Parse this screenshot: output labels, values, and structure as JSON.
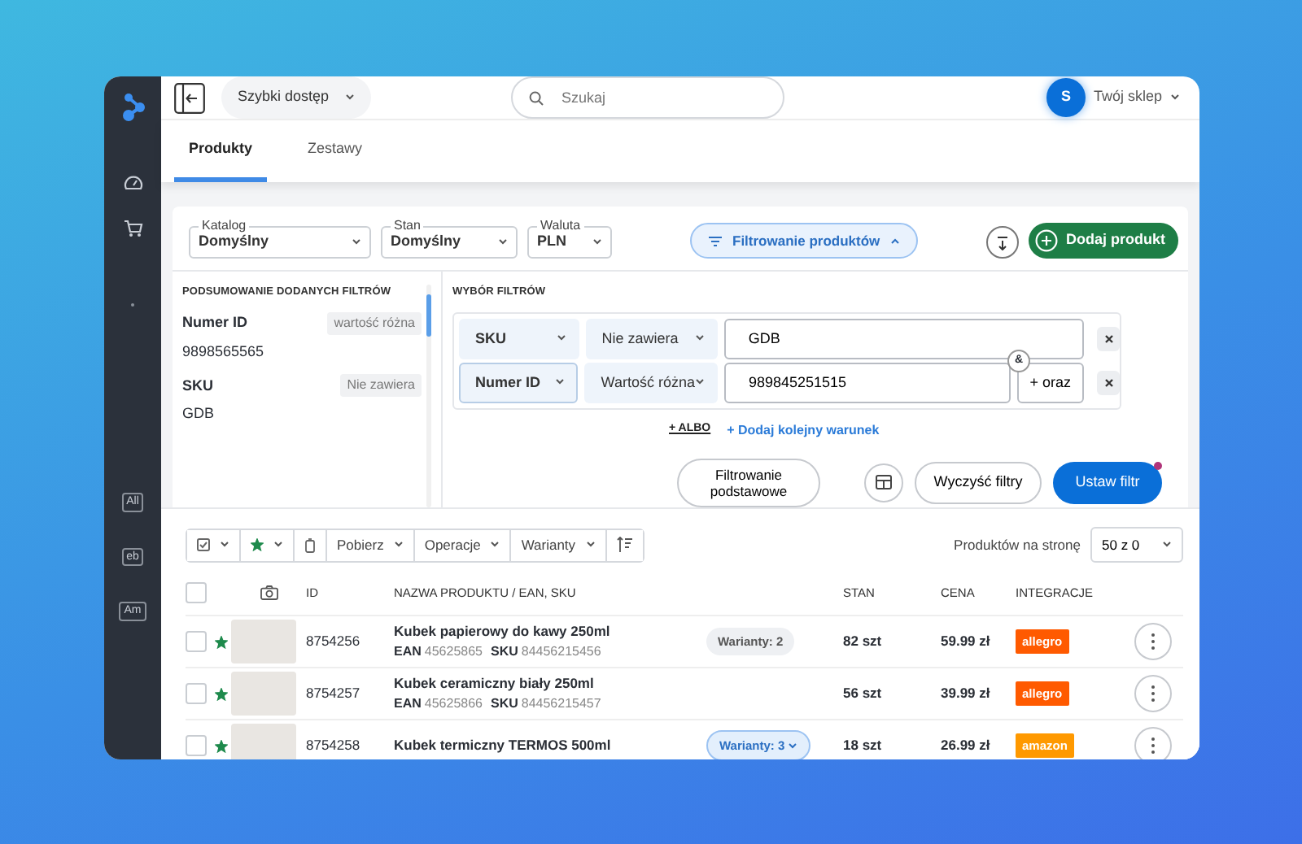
{
  "sidebar": {
    "channels": [
      "All",
      "eb",
      "Am"
    ]
  },
  "topbar": {
    "quick_access": "Szybki dostęp",
    "search": {
      "placeholder": "Szukaj"
    },
    "account": {
      "initial": "S",
      "name": "Twój sklep"
    }
  },
  "tabs": [
    {
      "label": "Produkty",
      "selected": true
    },
    {
      "label": "Zestawy",
      "selected": false
    }
  ],
  "filters": {
    "selects": [
      {
        "label": "Katalog",
        "value": "Domyślny"
      },
      {
        "label": "Stan",
        "value": "Domyślny"
      },
      {
        "label": "Waluta",
        "value": "PLN"
      }
    ],
    "toggle": {
      "label": "Filtrowanie produktów",
      "expanded": true
    },
    "add_button": "Dodaj produkt"
  },
  "summary": {
    "title": "PODSUMOWANIE DODANYCH FILTRÓW",
    "items": [
      {
        "field": "Numer ID",
        "condition": "wartość różna",
        "value": "9898565565"
      },
      {
        "field": "SKU",
        "condition": "Nie zawiera",
        "value": "GDB"
      }
    ]
  },
  "selection": {
    "title": "WYBÓR FILTRÓW",
    "rows": [
      {
        "field": "SKU",
        "operator": "Nie zawiera",
        "value": "GDB"
      },
      {
        "field": "Numer ID",
        "operator": "Wartość różna",
        "value": "989845251515",
        "and_button": "+ oraz"
      }
    ],
    "joiner": "&",
    "or_link": "+ ALBO",
    "add_condition_link": "+ Dodaj kolejny warunek"
  },
  "filter_actions": {
    "basic": "Filtrowanie podstawowe",
    "clear": "Wyczyść filtry",
    "apply": "Ustaw filtr",
    "apply_notification": true
  },
  "toolbar": {
    "buttons": [
      "Pobierz",
      "Operacje",
      "Warianty"
    ],
    "per_page_label": "Produktów na stronę",
    "per_page": "50 z 0"
  },
  "table": {
    "select_all_checked": false,
    "columns": [
      "ID",
      "NAZWA PRODUKTU / EAN, SKU",
      "STAN",
      "CENA",
      "INTEGRACJE"
    ],
    "rows": [
      {
        "checked": false,
        "starred": true,
        "id": "8754256",
        "name": "Kubek papierowy do kawy 250ml",
        "ean_label": "EAN",
        "ean": "45625865",
        "sku_label": "SKU",
        "sku": "84456215456",
        "variants": "Warianty: 2",
        "variants_active": false,
        "stock": "82 szt",
        "price": "59.99 zł",
        "integration": {
          "label": "allegro",
          "color": "#ff5a00"
        }
      },
      {
        "checked": false,
        "starred": true,
        "id": "8754257",
        "name": "Kubek ceramiczny biały 250ml",
        "ean_label": "EAN",
        "ean": "45625866",
        "sku_label": "SKU",
        "sku": "84456215457",
        "stock": "56 szt",
        "price": "39.99 zł",
        "integration": {
          "label": "allegro",
          "color": "#ff5a00"
        }
      },
      {
        "checked": false,
        "starred": true,
        "id": "8754258",
        "name": "Kubek termiczny TERMOS 500ml",
        "variants": "Warianty: 3",
        "variants_active": true,
        "stock": "18 szt",
        "price": "26.99 zł",
        "integration": {
          "label": "amazon",
          "color": "#ff9900"
        }
      }
    ]
  }
}
